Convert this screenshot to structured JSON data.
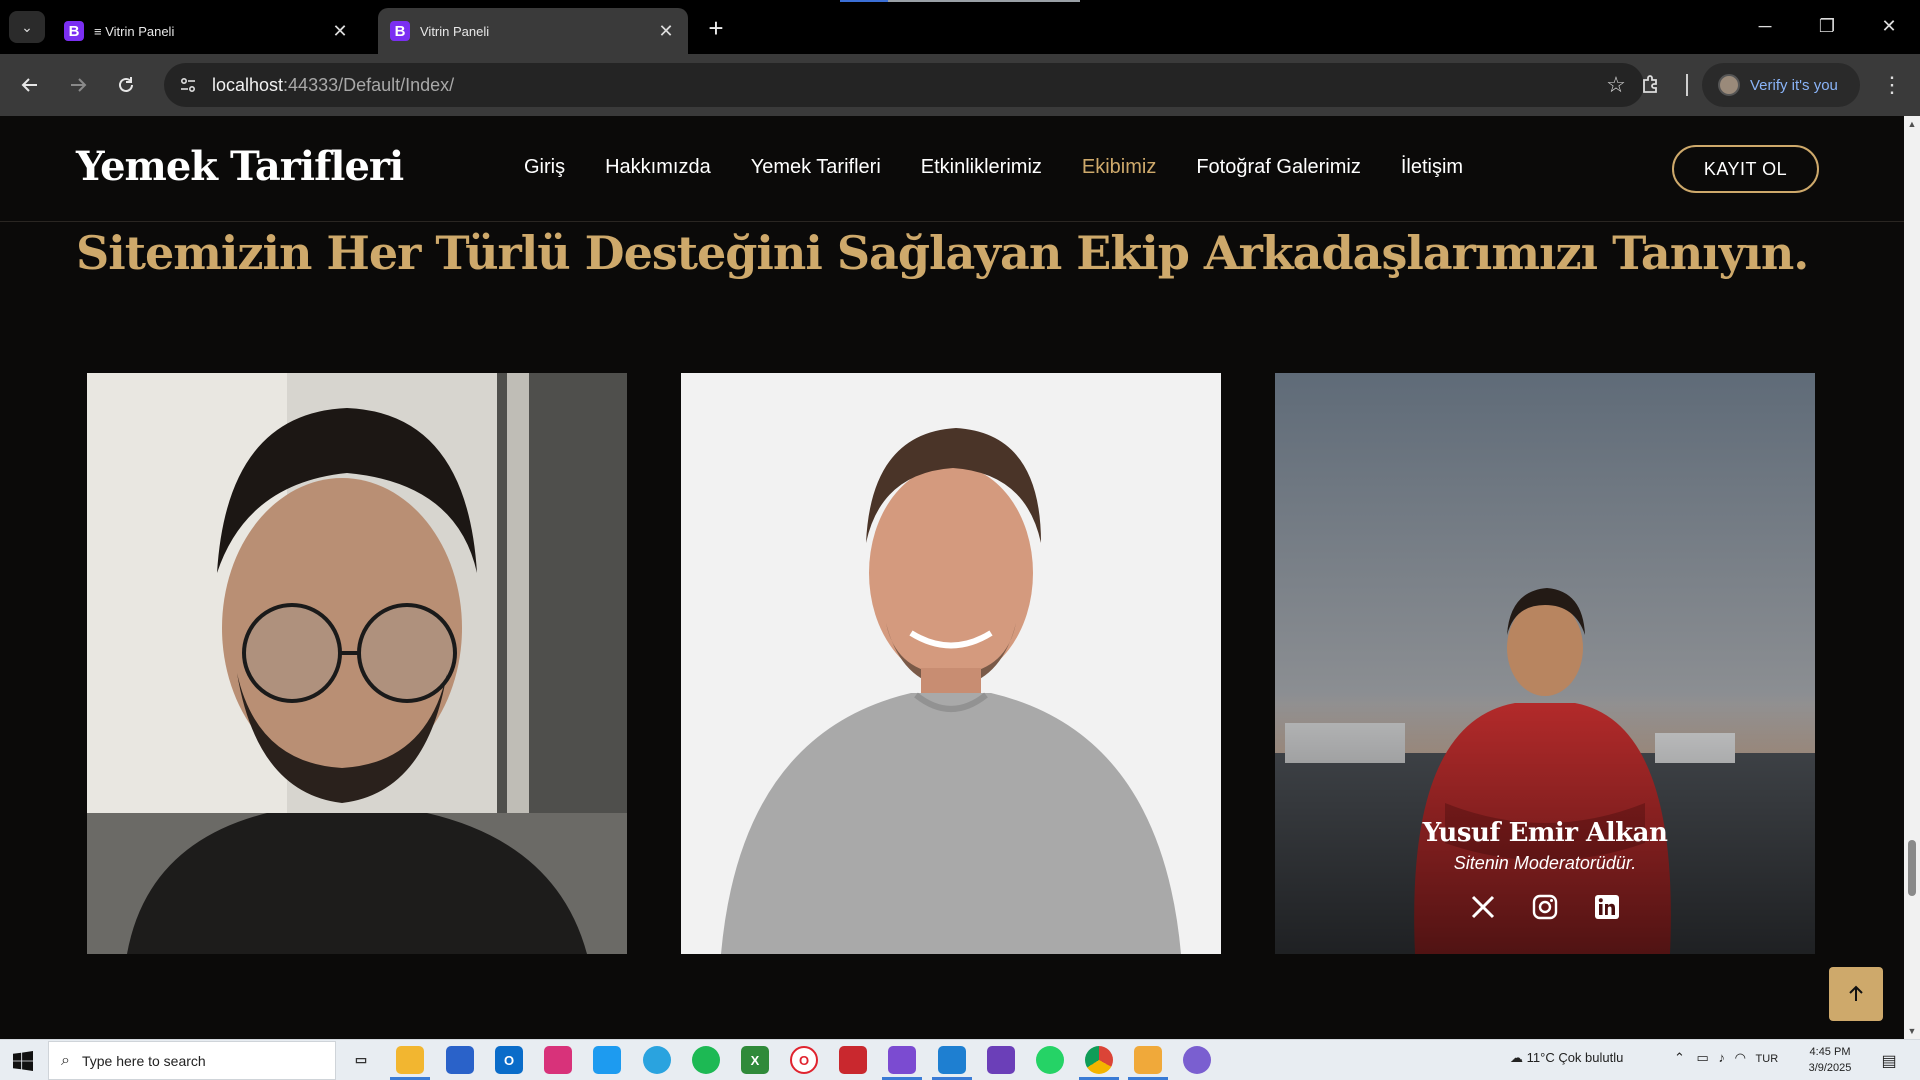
{
  "browser": {
    "tabs": [
      {
        "title": "≡ Vitrin Paneli",
        "favicon": "B",
        "active": false
      },
      {
        "title": "Vitrin Paneli",
        "favicon": "B",
        "active": true
      }
    ],
    "url_host": "localhost",
    "url_rest": ":44333/Default/Index/",
    "profile_label": "Verify it's you"
  },
  "site": {
    "brand": "Yemek Tarifleri",
    "menu": [
      {
        "label": "Giriş",
        "active": false
      },
      {
        "label": "Hakkımızda",
        "active": false
      },
      {
        "label": "Yemek Tarifleri",
        "active": false
      },
      {
        "label": "Etkinliklerimiz",
        "active": false
      },
      {
        "label": "Ekibimiz",
        "active": true
      },
      {
        "label": "Fotoğraf Galerimiz",
        "active": false
      },
      {
        "label": "İletişim",
        "active": false
      }
    ],
    "cta": "KAYIT OL",
    "accent_color": "#cea96b"
  },
  "team": {
    "heading": "Sitemizin Her Türlü Desteğini Sağlayan Ekip Arkadaşlarımızı Tanıyın.",
    "members": [
      {
        "name": "",
        "role": ""
      },
      {
        "name": "",
        "role": ""
      },
      {
        "name": "Yusuf Emir Alkan",
        "role": "Sitenin Moderatorüdür.",
        "socials": [
          "x-icon",
          "instagram-icon",
          "linkedin-icon"
        ]
      }
    ]
  },
  "taskbar": {
    "search_placeholder": "Type here to search",
    "weather": "11°C  Çok bulutlu",
    "language": "TUR",
    "time": "4:45 PM",
    "date": "3/9/2025"
  }
}
